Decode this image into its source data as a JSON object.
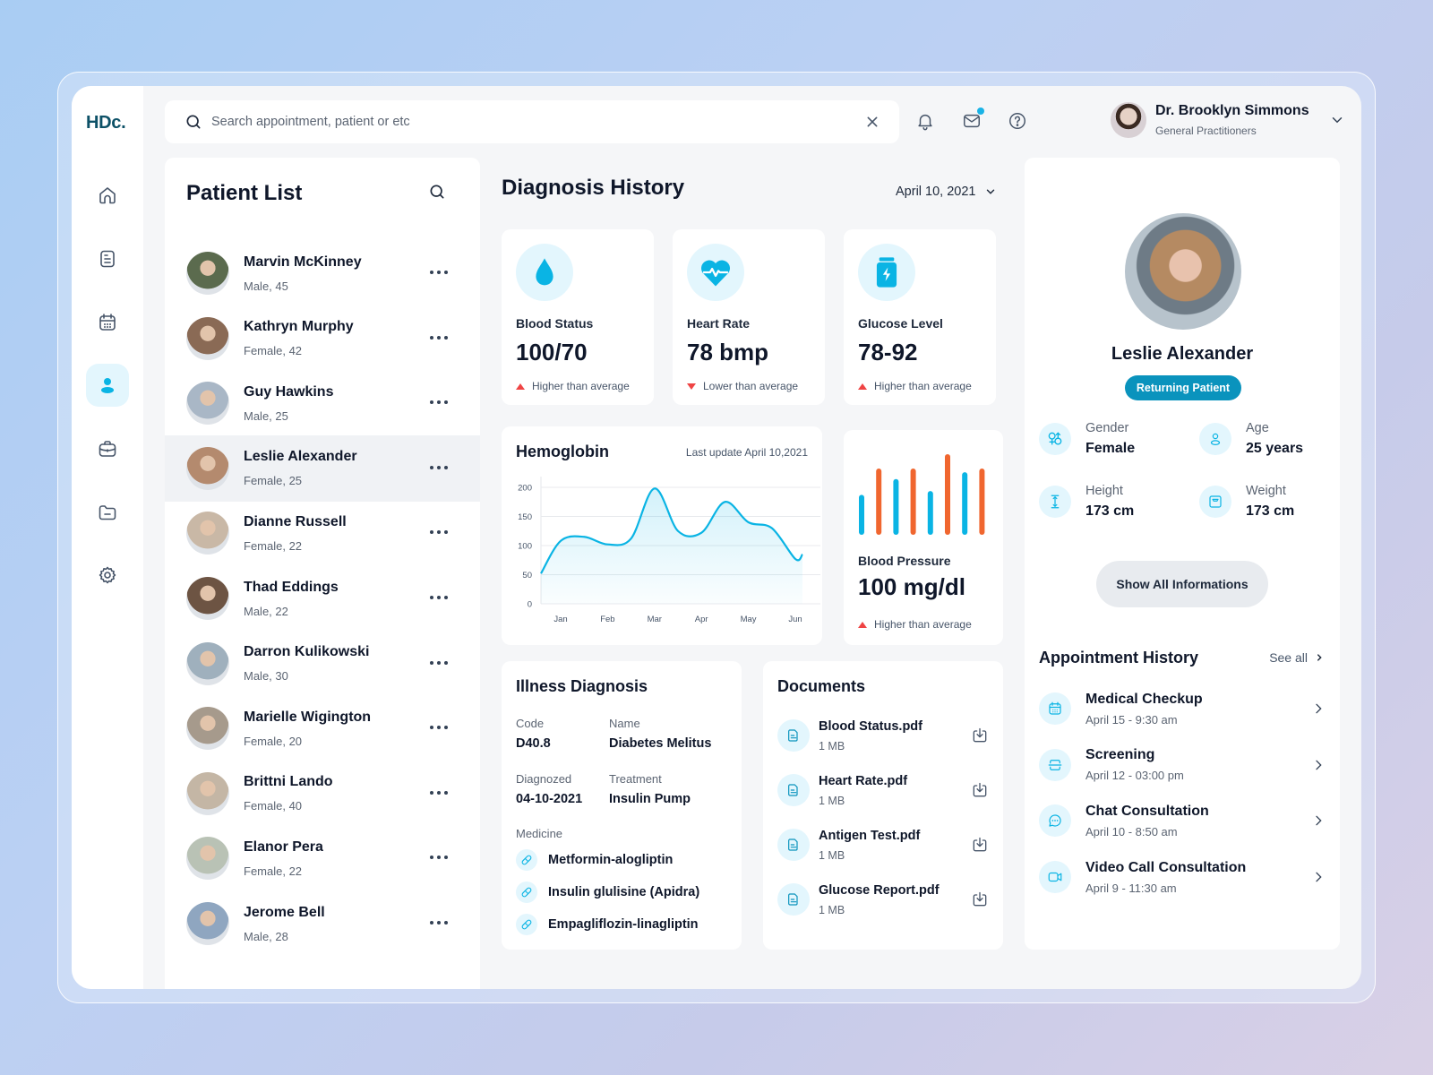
{
  "app": {
    "logo": "HDc.",
    "accent_color": "#0ab4e4",
    "orange_color": "#f0662f"
  },
  "sidebar": {
    "items": [
      {
        "name": "home",
        "icon": "home-icon",
        "active": false
      },
      {
        "name": "documents",
        "icon": "document-icon",
        "active": false
      },
      {
        "name": "calendar",
        "icon": "calendar-icon",
        "active": false
      },
      {
        "name": "patients",
        "icon": "user-icon",
        "active": true
      },
      {
        "name": "briefcase",
        "icon": "briefcase-icon",
        "active": false
      },
      {
        "name": "folder",
        "icon": "folder-icon",
        "active": false
      },
      {
        "name": "settings",
        "icon": "gear-icon",
        "active": false
      }
    ]
  },
  "topbar": {
    "search_placeholder": "Search appointment, patient or etc",
    "search_value": "",
    "user": {
      "name": "Dr. Brooklyn Simmons",
      "role": "General Practitioners"
    }
  },
  "patient_list": {
    "title": "Patient List",
    "patients": [
      {
        "name": "Marvin McKinney",
        "meta": "Male, 45",
        "selected": false,
        "avatar_color": "#5b6b4e"
      },
      {
        "name": "Kathryn Murphy",
        "meta": "Female, 42",
        "selected": false,
        "avatar_color": "#8a6a55"
      },
      {
        "name": "Guy Hawkins",
        "meta": "Male, 25",
        "selected": false,
        "avatar_color": "#a9b7c6"
      },
      {
        "name": "Leslie Alexander",
        "meta": "Female, 25",
        "selected": true,
        "avatar_color": "#b48a6e"
      },
      {
        "name": "Dianne Russell",
        "meta": "Female, 22",
        "selected": false,
        "avatar_color": "#c9b8a6"
      },
      {
        "name": "Thad Eddings",
        "meta": "Male, 22",
        "selected": false,
        "avatar_color": "#6d5443"
      },
      {
        "name": "Darron Kulikowski",
        "meta": "Male, 30",
        "selected": false,
        "avatar_color": "#9fb0bd"
      },
      {
        "name": "Marielle Wigington",
        "meta": "Female, 20",
        "selected": false,
        "avatar_color": "#a69a8c"
      },
      {
        "name": "Brittni Lando",
        "meta": "Female, 40",
        "selected": false,
        "avatar_color": "#c4b6a5"
      },
      {
        "name": "Elanor Pera",
        "meta": "Female, 22",
        "selected": false,
        "avatar_color": "#b9c2b5"
      },
      {
        "name": "Jerome Bell",
        "meta": "Male, 28",
        "selected": false,
        "avatar_color": "#8fa6c0"
      }
    ]
  },
  "diagnosis": {
    "title": "Diagnosis History",
    "date": "April 10, 2021",
    "stats": [
      {
        "label": "Blood Status",
        "value": "100/70",
        "trend": "Higher than average",
        "direction": "up",
        "icon": "blood-drop-icon"
      },
      {
        "label": "Heart Rate",
        "value": "78 bmp",
        "trend": "Lower than average",
        "direction": "down",
        "icon": "heart-pulse-icon"
      },
      {
        "label": "Glucose Level",
        "value": "78-92",
        "trend": "Higher than average",
        "direction": "up",
        "icon": "glucose-jar-icon"
      }
    ],
    "blood_pressure": {
      "label": "Blood Pressure",
      "value": "100 mg/dl",
      "trend": "Higher than average",
      "bars": [
        {
          "value": 0.46,
          "color": "blue"
        },
        {
          "value": 0.81,
          "color": "orange"
        },
        {
          "value": 0.67,
          "color": "blue"
        },
        {
          "value": 0.81,
          "color": "orange"
        },
        {
          "value": 0.51,
          "color": "blue"
        },
        {
          "value": 1.0,
          "color": "orange"
        },
        {
          "value": 0.76,
          "color": "blue"
        },
        {
          "value": 0.81,
          "color": "orange"
        }
      ]
    }
  },
  "chart_data": {
    "type": "area",
    "title": "Hemoglobin",
    "subtitle": "Last update April 10,2021",
    "xlabel": "",
    "ylabel": "",
    "ylim": [
      0,
      200
    ],
    "yticks": [
      0,
      50,
      100,
      150,
      200
    ],
    "grid": true,
    "categories": [
      "Jan",
      "Feb",
      "Mar",
      "Apr",
      "May",
      "Jun"
    ],
    "x": [
      -0.5,
      0.0,
      0.5,
      1.0,
      1.5,
      2.0,
      2.5,
      3.0,
      3.5,
      4.0,
      4.5,
      5.0,
      5.5
    ],
    "series": [
      {
        "name": "Hemoglobin",
        "values": [
          52,
          108,
          115,
          102,
          112,
          198,
          125,
          122,
          175,
          140,
          130,
          77,
          85
        ]
      }
    ]
  },
  "illness": {
    "title": "Illness Diagnosis",
    "code_label": "Code",
    "code": "D40.8",
    "name_label": "Name",
    "name": "Diabetes Melitus",
    "diagnozed_label": "Diagnozed",
    "diagnozed": "04-10-2021",
    "treatment_label": "Treatment",
    "treatment": "Insulin Pump",
    "medicine_label": "Medicine",
    "medicines": [
      "Metformin-alogliptin",
      "Insulin glulisine (Apidra)",
      "Empagliflozin-linagliptin"
    ]
  },
  "documents": {
    "title": "Documents",
    "files": [
      {
        "name": "Blood Status.pdf",
        "size": "1 MB"
      },
      {
        "name": "Heart Rate.pdf",
        "size": "1 MB"
      },
      {
        "name": "Antigen Test.pdf",
        "size": "1 MB"
      },
      {
        "name": "Glucose Report.pdf",
        "size": "1 MB"
      }
    ]
  },
  "patient_profile": {
    "name": "Leslie Alexander",
    "badge": "Returning Patient",
    "attributes": [
      {
        "label": "Gender",
        "value": "Female",
        "icon": "gender-icon"
      },
      {
        "label": "Age",
        "value": "25 years",
        "icon": "age-icon"
      },
      {
        "label": "Height",
        "value": "173 cm",
        "icon": "height-icon"
      },
      {
        "label": "Weight",
        "value": "173 cm",
        "icon": "weight-scale-icon"
      }
    ],
    "show_all_label": "Show All Informations",
    "appointments_title": "Appointment History",
    "see_all_label": "See all",
    "appointments": [
      {
        "name": "Medical Checkup",
        "time": "April 15 - 9:30 am",
        "icon": "calendar-icon"
      },
      {
        "name": "Screening",
        "time": "April 12 - 03:00 pm",
        "icon": "scan-icon"
      },
      {
        "name": "Chat Consultation",
        "time": "April 10 - 8:50 am",
        "icon": "chat-icon"
      },
      {
        "name": "Video Call Consultation",
        "time": "April 9 - 11:30 am",
        "icon": "video-icon"
      }
    ]
  }
}
